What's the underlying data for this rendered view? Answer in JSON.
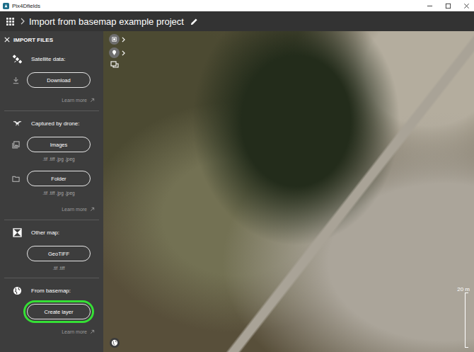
{
  "window": {
    "title": "Pix4Dfields"
  },
  "header": {
    "title": "Import from basemap example project"
  },
  "panel": {
    "title": "IMPORT FILES",
    "sections": [
      {
        "kind": "satellite",
        "heading": "Satellite data:",
        "rows": [
          {
            "kind": "download",
            "button": "Download",
            "formats": "",
            "highlighted": false
          }
        ],
        "learn_more": "Learn more"
      },
      {
        "kind": "drone",
        "heading": "Captured by drone:",
        "rows": [
          {
            "kind": "images",
            "button": "Images",
            "formats": ".tif .tiff .jpg .jpeg",
            "highlighted": false
          },
          {
            "kind": "folder",
            "button": "Folder",
            "formats": ".tif .tiff .jpg .jpeg",
            "highlighted": false
          }
        ],
        "learn_more": "Learn more"
      },
      {
        "kind": "map",
        "heading": "Other map:",
        "rows": [
          {
            "kind": "none",
            "button": "GeoTIFF",
            "formats": ".tif .tiff",
            "highlighted": false
          }
        ],
        "learn_more": ""
      },
      {
        "kind": "basemap",
        "heading": "From basemap:",
        "rows": [
          {
            "kind": "none",
            "button": "Create layer",
            "formats": "",
            "highlighted": true
          }
        ],
        "learn_more": "Learn more"
      }
    ]
  },
  "map": {
    "scale": "20 m"
  }
}
